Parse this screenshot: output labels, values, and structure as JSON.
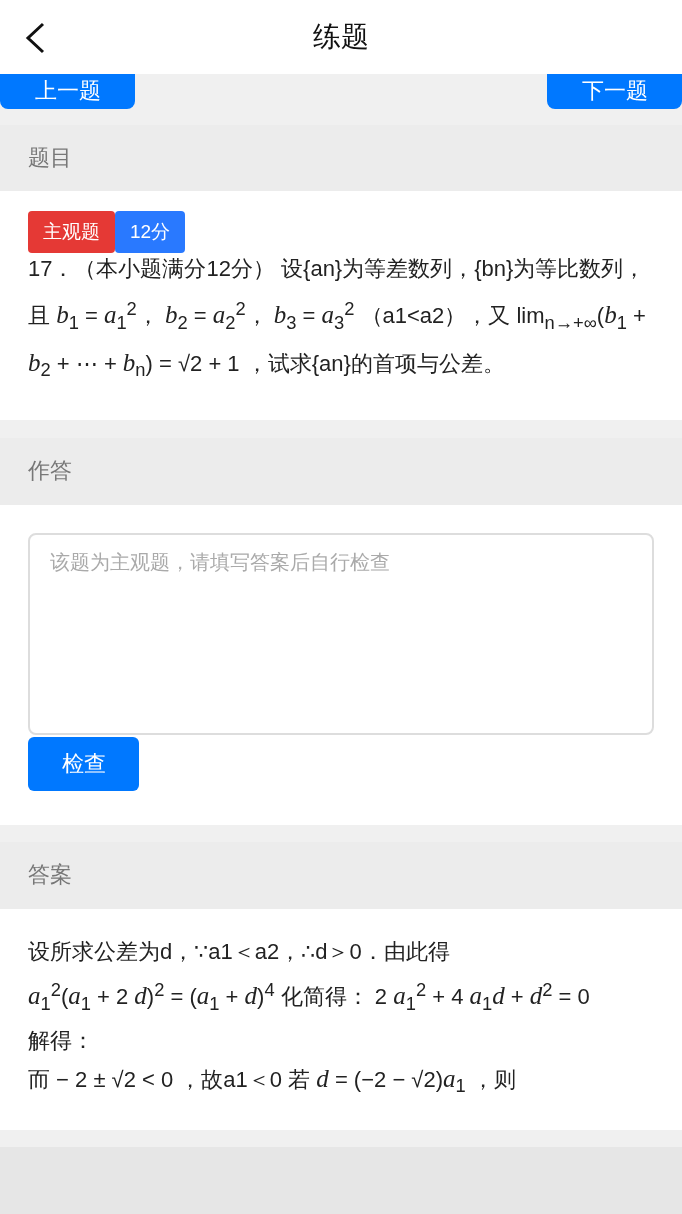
{
  "header": {
    "title": "练题"
  },
  "nav_buttons": [
    {
      "label": "上一题"
    },
    {
      "label": "下一题"
    }
  ],
  "sections": [
    {
      "kind": "question",
      "title": "题目",
      "tags": [
        {
          "label": "主观题",
          "color": "#e53935"
        },
        {
          "label": "12分",
          "color": "#2979ff"
        }
      ],
      "text": "17．（本小题满分12分） 设{an}为等差数列，{bn}为等比数列，且 *b*$_{1}$ = *a*$_{1}$$^{2}$， *b*$_{2}$ = *a*$_{2}$$^{2}$， *b*$_{3}$ = *a*$_{3}$$^{2}$ （a1<a2），又 lim$_{n→+∞}$(*b*$_{1}$ + *b*$_{2}$ + ⋯ + *b*$_{n}$) = √2 + 1 ，试求{an}的首项与公差。"
    },
    {
      "kind": "answer_input",
      "title": "作答",
      "placeholder": "该题为主观题，请填写答案后自行检查",
      "button": "检查"
    },
    {
      "kind": "solution",
      "title": "答案",
      "lines": [
        "设所求公差为d，∵a1＜a2，∴d＞0．由此得",
        "*a*$_{1}$$^{2}$(*a*$_{1}$ + 2 *d*)$^{2}$ = (*a*$_{1}$ + *d*)$^{4}$ 化简得： 2 *a*$_{1}$$^{2}$ + 4 *a*$_{1}$*d* + *d*$^{2}$ = 0",
        "解得：",
        "而 − 2 ± √2 < 0 ，故a1＜0 若 *d* = (−2 − √2)*a*$_{1}$ ，则"
      ]
    }
  ]
}
